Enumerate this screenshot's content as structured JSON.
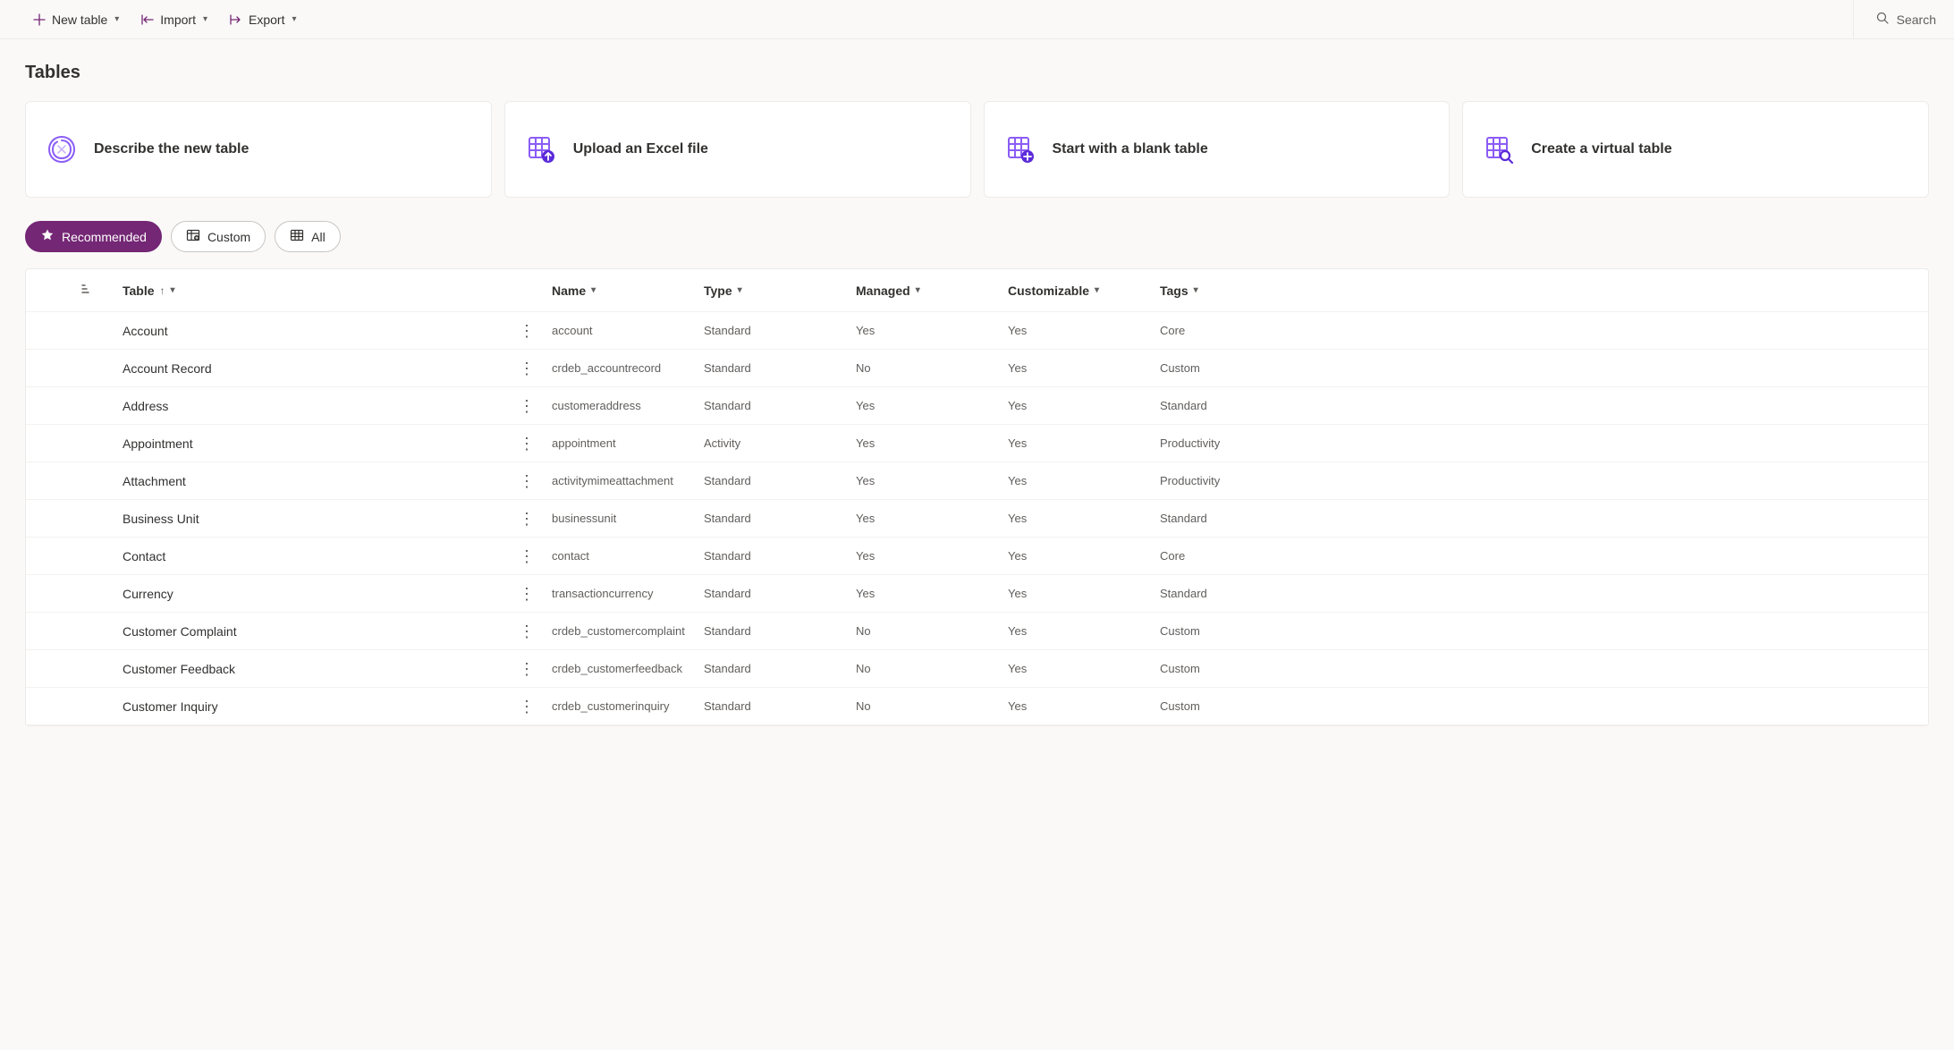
{
  "commandBar": {
    "newTable": "New table",
    "import": "Import",
    "export": "Export",
    "search": "Search"
  },
  "pageTitle": "Tables",
  "cards": [
    {
      "label": "Describe the new table",
      "icon": "copilot-icon"
    },
    {
      "label": "Upload an Excel file",
      "icon": "table-upload-icon"
    },
    {
      "label": "Start with a blank table",
      "icon": "table-add-icon"
    },
    {
      "label": "Create a virtual table",
      "icon": "table-search-icon"
    }
  ],
  "filters": {
    "recommended": "Recommended",
    "custom": "Custom",
    "all": "All"
  },
  "columns": {
    "table": "Table",
    "name": "Name",
    "type": "Type",
    "managed": "Managed",
    "customizable": "Customizable",
    "tags": "Tags"
  },
  "rows": [
    {
      "table": "Account",
      "name": "account",
      "type": "Standard",
      "managed": "Yes",
      "customizable": "Yes",
      "tags": "Core"
    },
    {
      "table": "Account Record",
      "name": "crdeb_accountrecord",
      "type": "Standard",
      "managed": "No",
      "customizable": "Yes",
      "tags": "Custom"
    },
    {
      "table": "Address",
      "name": "customeraddress",
      "type": "Standard",
      "managed": "Yes",
      "customizable": "Yes",
      "tags": "Standard"
    },
    {
      "table": "Appointment",
      "name": "appointment",
      "type": "Activity",
      "managed": "Yes",
      "customizable": "Yes",
      "tags": "Productivity"
    },
    {
      "table": "Attachment",
      "name": "activitymimeattachment",
      "type": "Standard",
      "managed": "Yes",
      "customizable": "Yes",
      "tags": "Productivity"
    },
    {
      "table": "Business Unit",
      "name": "businessunit",
      "type": "Standard",
      "managed": "Yes",
      "customizable": "Yes",
      "tags": "Standard"
    },
    {
      "table": "Contact",
      "name": "contact",
      "type": "Standard",
      "managed": "Yes",
      "customizable": "Yes",
      "tags": "Core"
    },
    {
      "table": "Currency",
      "name": "transactioncurrency",
      "type": "Standard",
      "managed": "Yes",
      "customizable": "Yes",
      "tags": "Standard"
    },
    {
      "table": "Customer Complaint",
      "name": "crdeb_customercomplaint",
      "type": "Standard",
      "managed": "No",
      "customizable": "Yes",
      "tags": "Custom"
    },
    {
      "table": "Customer Feedback",
      "name": "crdeb_customerfeedback",
      "type": "Standard",
      "managed": "No",
      "customizable": "Yes",
      "tags": "Custom"
    },
    {
      "table": "Customer Inquiry",
      "name": "crdeb_customerinquiry",
      "type": "Standard",
      "managed": "No",
      "customizable": "Yes",
      "tags": "Custom"
    }
  ],
  "colors": {
    "brand": "#742774",
    "brandLight": "#8b5cf6"
  }
}
